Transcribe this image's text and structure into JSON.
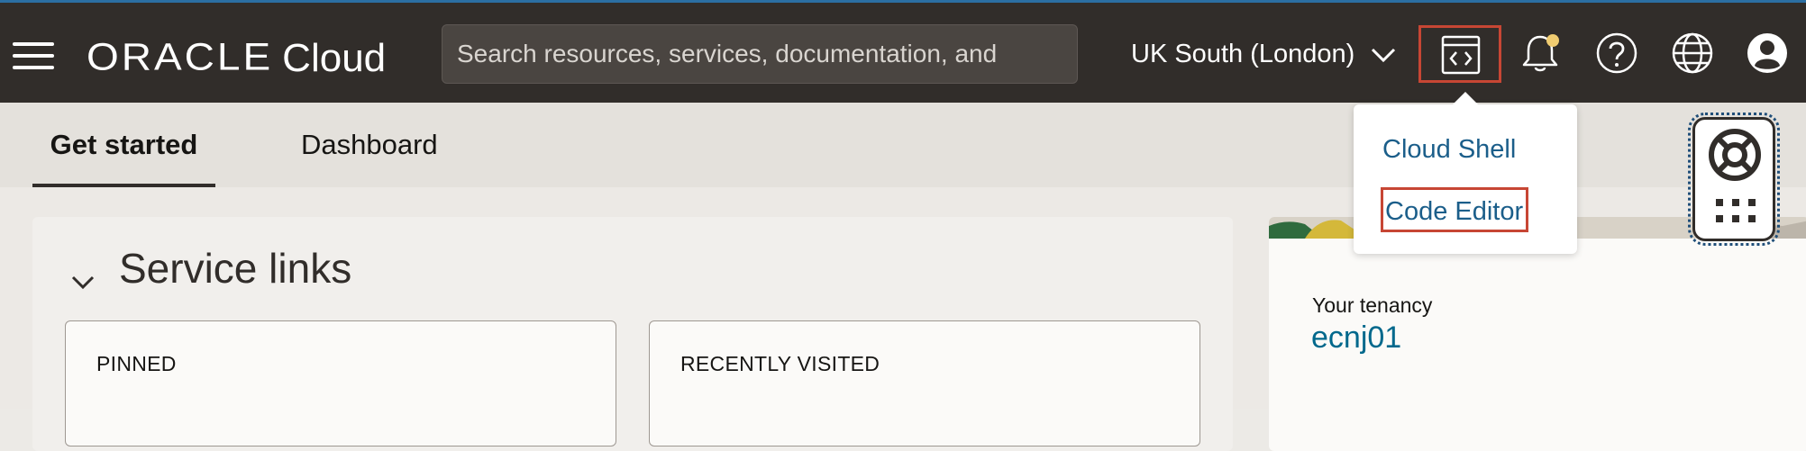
{
  "header": {
    "menu_icon": "hamburger-menu-icon",
    "logo_brand": "ORACLE",
    "logo_product": "Cloud",
    "search_placeholder": "Search resources, services, documentation, and",
    "region_label": "UK South (London)",
    "developer_tools_icon": "code-window-icon",
    "notifications_icon": "bell-icon",
    "help_icon": "help-circle-icon",
    "language_icon": "globe-icon",
    "profile_icon": "user-avatar-icon",
    "notification_dot_color": "#f0cc71"
  },
  "tabs": [
    {
      "label": "Get started",
      "active": true
    },
    {
      "label": "Dashboard",
      "active": false
    }
  ],
  "service_links": {
    "title": "Service links",
    "pinned_label": "PINNED",
    "recent_label": "RECENTLY VISITED"
  },
  "tenancy": {
    "label": "Your tenancy",
    "value": "ecnj01"
  },
  "developer_menu": {
    "items": [
      "Cloud Shell",
      "Code Editor"
    ],
    "highlighted": "Code Editor"
  },
  "help_widget": {
    "icon": "lifebuoy-icon",
    "grid_icon": "app-grid-icon"
  },
  "colors": {
    "topbar": "#312d2a",
    "highlight": "#c74634",
    "link": "#00688c"
  }
}
